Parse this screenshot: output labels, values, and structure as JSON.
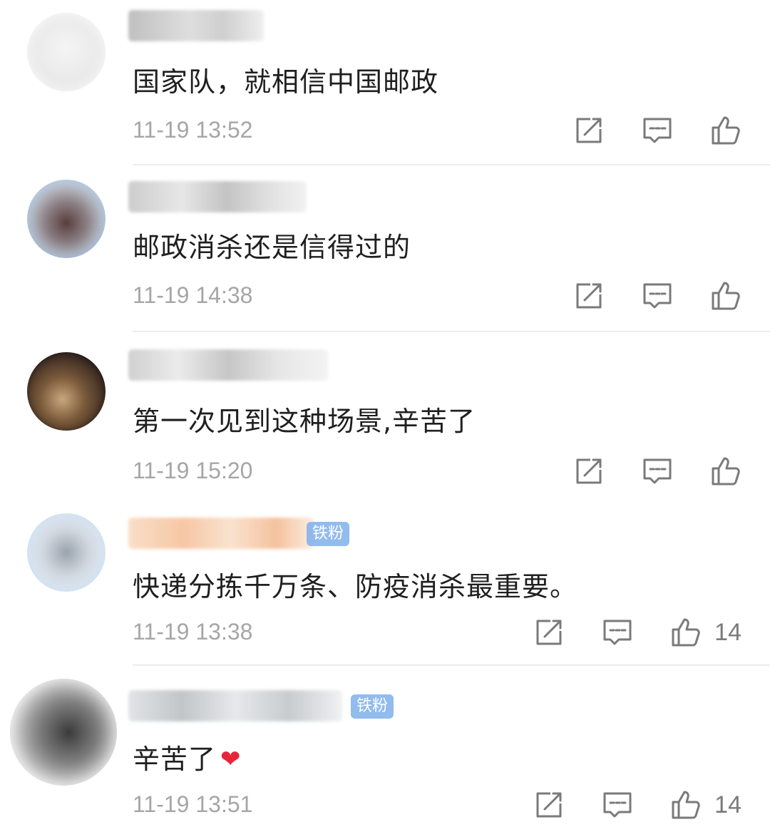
{
  "comments": [
    {
      "text": "国家队，就相信中国邮政",
      "time": "11-19 13:52",
      "likes": "",
      "badge": ""
    },
    {
      "text": "邮政消杀还是信得过的",
      "time": "11-19 14:38",
      "likes": "",
      "badge": ""
    },
    {
      "text": "第一次见到这种场景,辛苦了",
      "time": "11-19 15:20",
      "likes": "",
      "badge": ""
    },
    {
      "text": "快递分拣千万条、防疫消杀最重要。",
      "time": "11-19 13:38",
      "likes": "14",
      "badge": "铁粉"
    },
    {
      "text": "辛苦了",
      "time": "11-19 13:51",
      "likes": "14",
      "badge": "铁粉",
      "emoji": "❤"
    }
  ],
  "icons": {
    "share": "share-icon",
    "reply": "comment-icon",
    "like": "thumbs-up-icon"
  },
  "colors": {
    "text": "#1f1f1f",
    "meta": "#a6a6a6",
    "icon": "#7a7a7a",
    "badge": "#7fb0ec",
    "heart": "#e8243b"
  }
}
